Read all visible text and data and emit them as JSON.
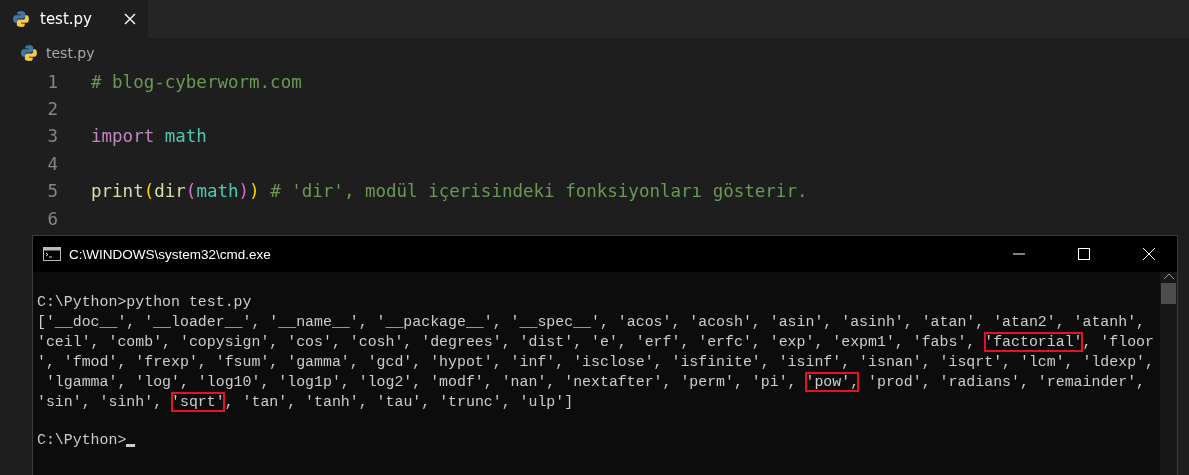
{
  "tabs": [
    {
      "label": "test.py",
      "selected": true
    }
  ],
  "breadcrumb": "test.py",
  "code_lines": [
    {
      "number": "1",
      "tokens": [
        {
          "kind": "comment",
          "text": "# blog-cyberworm.com"
        }
      ]
    },
    {
      "number": "2"
    },
    {
      "number": "3",
      "tokens": [
        {
          "kind": "keyword",
          "text": "import"
        },
        {
          "kind": "module",
          "text": "math",
          "space_before": true
        }
      ]
    },
    {
      "number": "4"
    },
    {
      "number": "5",
      "tokens": [
        {
          "kind": "function",
          "text": "print"
        },
        {
          "kind": "bracket1",
          "text": "("
        },
        {
          "kind": "function",
          "text": "dir"
        },
        {
          "kind": "bracket2",
          "text": "("
        },
        {
          "kind": "module",
          "text": "math"
        },
        {
          "kind": "bracket2",
          "text": ")"
        },
        {
          "kind": "bracket1",
          "text": ")"
        },
        {
          "kind": "comment",
          "space_before": true,
          "text": "# 'dir', modül içerisindeki fonksiyonları gösterir."
        }
      ]
    },
    {
      "number": "6"
    }
  ],
  "console": {
    "title": "C:\\WINDOWS\\system32\\cmd.exe",
    "lines": [
      {
        "segments": [
          {
            "text": "C:\\Python>python test.py",
            "highlighted": false
          }
        ]
      },
      {
        "segments": [
          {
            "text": "['__doc__', '__loader__', '__name__', '__package__', '__spec__', 'acos', 'acosh', 'asin', 'asinh', 'atan', 'atan2', 'atanh',",
            "highlighted": false
          }
        ]
      },
      {
        "segments": [
          {
            "text": "'ceil', 'comb', 'copysign', 'cos', 'cosh', 'degrees', 'dist', 'e', 'erf', 'erfc', 'exp', 'expm1', 'fabs', ",
            "highlighted": false
          },
          {
            "text": "'factorial'",
            "highlighted": true
          },
          {
            "text": ", 'floor",
            "highlighted": false
          }
        ]
      },
      {
        "segments": [
          {
            "text": "', 'fmod', 'frexp', 'fsum', 'gamma', 'gcd', 'hypot', 'inf', 'isclose', 'isfinite', 'isinf', 'isnan', 'isqrt', 'lcm', 'ldexp',",
            "highlighted": false
          }
        ]
      },
      {
        "segments": [
          {
            "text": " 'lgamma', 'log', 'log10', 'log1p', 'log2', 'modf', 'nan', 'nextafter', 'perm', 'pi', ",
            "highlighted": false
          },
          {
            "text": "'pow',",
            "highlighted": true
          },
          {
            "text": " 'prod', 'radians', 'remainder',",
            "highlighted": false
          }
        ]
      },
      {
        "segments": [
          {
            "text": "'sin', 'sinh', ",
            "highlighted": false
          },
          {
            "text": "'sqrt'",
            "highlighted": true
          },
          {
            "text": ", 'tan', 'tanh', 'tau', 'trunc', 'ulp']",
            "highlighted": false
          }
        ]
      },
      {
        "segments": [
          {
            "text": "C:\\Python>",
            "highlighted": false
          }
        ],
        "gap_before": true
      }
    ],
    "cursor": true
  }
}
